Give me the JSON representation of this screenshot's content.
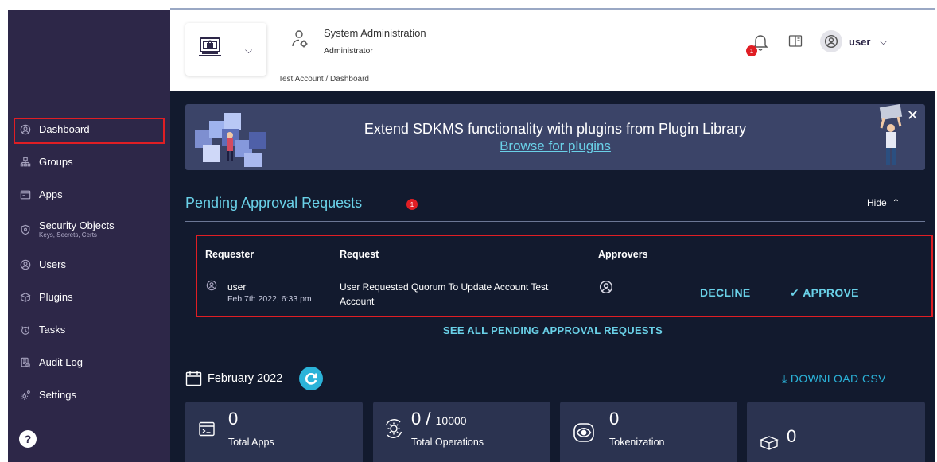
{
  "sidebar": {
    "items": [
      {
        "label": "Dashboard",
        "sub": "",
        "icon": "dashboard-icon"
      },
      {
        "label": "Groups",
        "sub": "",
        "icon": "groups-icon"
      },
      {
        "label": "Apps",
        "sub": "",
        "icon": "apps-icon"
      },
      {
        "label": "Security Objects",
        "sub": "Keys, Secrets, Certs",
        "icon": "security-objects-icon"
      },
      {
        "label": "Users",
        "sub": "",
        "icon": "users-icon"
      },
      {
        "label": "Plugins",
        "sub": "",
        "icon": "plugins-icon"
      },
      {
        "label": "Tasks",
        "sub": "",
        "icon": "tasks-icon"
      },
      {
        "label": "Audit Log",
        "sub": "",
        "icon": "audit-log-icon"
      },
      {
        "label": "Settings",
        "sub": "",
        "icon": "settings-icon"
      }
    ],
    "active": "Dashboard",
    "help_label": "?"
  },
  "header": {
    "role_title": "System Administration",
    "role_sub": "Administrator",
    "breadcrumb": "Test Account / Dashboard",
    "notification_count": "1",
    "username": "user"
  },
  "banner": {
    "text": "Extend SDKMS functionality with plugins from Plugin Library",
    "link": "Browse for plugins",
    "close": "✕"
  },
  "pending": {
    "title": "Pending Approval Requests",
    "count": "1",
    "hide_label": "Hide",
    "columns": {
      "requester": "Requester",
      "request": "Request",
      "approvers": "Approvers"
    },
    "row": {
      "requester_name": "user",
      "requester_date": "Feb 7th 2022, 6:33 pm",
      "request_line1": "User Requested Quorum To Update Account Test",
      "request_line2": "Account"
    },
    "decline_label": "DECLINE",
    "approve_label": "APPROVE",
    "see_all_label": "SEE ALL PENDING APPROVAL REQUESTS"
  },
  "stats": {
    "month": "February 2022",
    "download_label": "DOWNLOAD CSV",
    "cards": [
      {
        "value": "0",
        "label": "Total Apps"
      },
      {
        "value": "0",
        "separator": "/",
        "limit": "10000",
        "label": "Total Operations"
      },
      {
        "value": "0",
        "label": "Tokenization"
      },
      {
        "value": "0",
        "label": ""
      }
    ]
  },
  "colors": {
    "sidebar_bg": "#2d2748",
    "main_bg": "#121a2e",
    "accent": "#6ad1e8",
    "highlight_red": "#e01e24",
    "card_bg": "#2b3350"
  }
}
